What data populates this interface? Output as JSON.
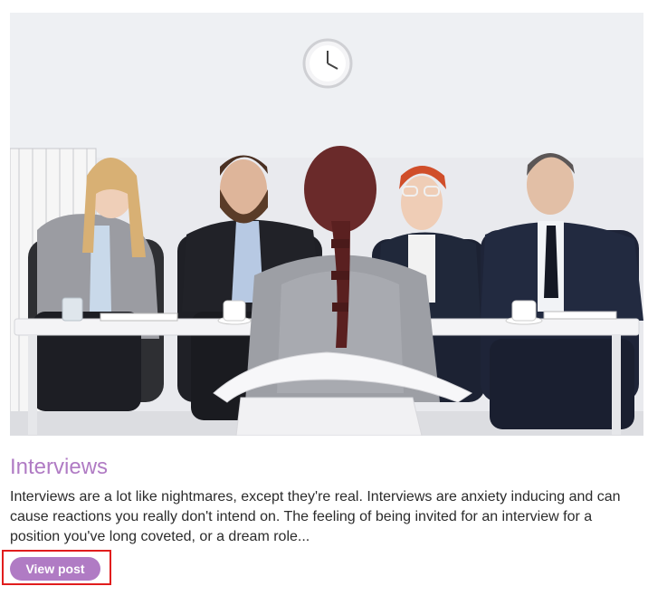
{
  "post": {
    "image_alt": "Job interview scene with a panel of four interviewers seated at a table facing a candidate",
    "title": "Interviews",
    "excerpt": "Interviews are a lot like nightmares, except they're real. Interviews are anxiety inducing and can cause reactions you really don't intend on. The feeling of being invited for an interview for a position you've long coveted, or a dream role...",
    "button_label": "View post"
  },
  "colors": {
    "accent": "#b07bc4",
    "highlight": "#e11d1d",
    "text": "#2b2b2b"
  }
}
